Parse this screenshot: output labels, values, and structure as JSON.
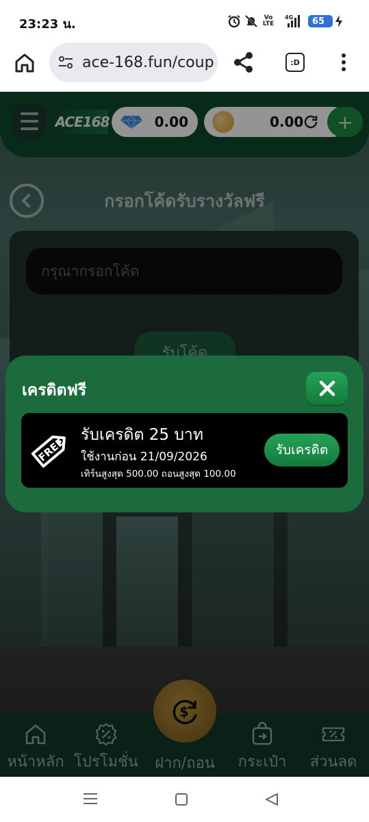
{
  "status_bar": {
    "time": "23:23 น.",
    "battery": "65",
    "icons": [
      "alarm-icon",
      "mute-icon",
      "volte-icon",
      "signal-4g-icon",
      "battery-icon",
      "charging-icon"
    ],
    "volte_label": "Vo LTE",
    "network_label": "4G"
  },
  "browser": {
    "url": "ace-168.fun/coup",
    "tab_label": ":D"
  },
  "header": {
    "logo_text": "ACE168",
    "gem_balance": "0.00",
    "coin_balance": "0.00",
    "plus_label": "+"
  },
  "page": {
    "title": "กรอกโค้ดรับรางวัลฟรี",
    "code_placeholder": "กรุณากรอกโค้ด",
    "claim_code_label": "รับโค้ด"
  },
  "dialog": {
    "title": "เครดิตฟรี",
    "coupon": {
      "tag_text": "FREE",
      "title": "รับเครดิต 25 บาท",
      "expiry": "ใช้งานก่อน 21/09/2026",
      "terms": "เทิร์นสูงสุด 500.00 ถอนสูงสุด 100.00",
      "claim_label": "รับเครดิต"
    }
  },
  "bottom_nav": {
    "items": [
      {
        "label": "หน้าหลัก",
        "icon": "home-icon"
      },
      {
        "label": "โปรโมชั่น",
        "icon": "percent-badge-icon"
      },
      {
        "label": "ฝาก/ถอน",
        "icon": "dollar-exchange-icon"
      },
      {
        "label": "กระเป๋า",
        "icon": "wallet-bag-icon"
      },
      {
        "label": "ส่วนลด",
        "icon": "coupon-icon"
      }
    ]
  },
  "colors": {
    "dialog_bg": "#1c6b3c",
    "button_green": "#1a8f48",
    "header_green": "#0f4a2c"
  }
}
